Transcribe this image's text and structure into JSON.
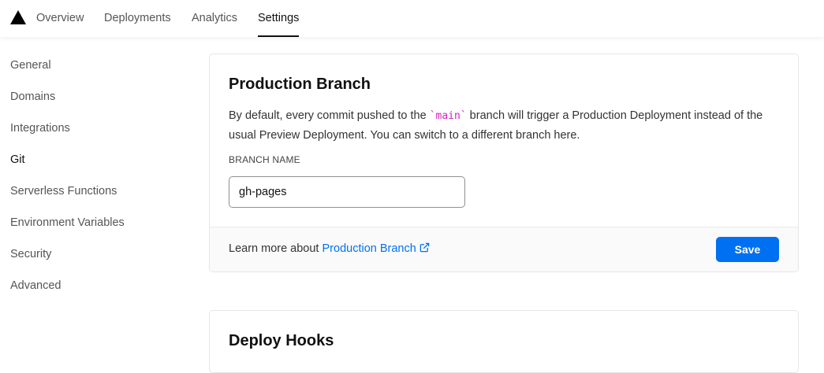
{
  "nav": {
    "tabs": [
      {
        "label": "Overview"
      },
      {
        "label": "Deployments"
      },
      {
        "label": "Analytics"
      },
      {
        "label": "Settings",
        "active": true
      }
    ]
  },
  "sidebar": {
    "items": [
      {
        "label": "General"
      },
      {
        "label": "Domains"
      },
      {
        "label": "Integrations"
      },
      {
        "label": "Git",
        "active": true
      },
      {
        "label": "Serverless Functions"
      },
      {
        "label": "Environment Variables"
      },
      {
        "label": "Security"
      },
      {
        "label": "Advanced"
      }
    ]
  },
  "production_branch": {
    "title": "Production Branch",
    "desc_before": "By default, every commit pushed to the ",
    "desc_code": "`main`",
    "desc_after": " branch will trigger a Production Deployment instead of the usual Preview Deployment. You can switch to a different branch here.",
    "field_label": "BRANCH NAME",
    "branch_value": "gh-pages",
    "footer_text": "Learn more about ",
    "footer_link": "Production Branch",
    "save_label": "Save"
  },
  "deploy_hooks": {
    "title": "Deploy Hooks"
  },
  "colors": {
    "accent": "#0070f3",
    "code": "#d61ec3"
  }
}
